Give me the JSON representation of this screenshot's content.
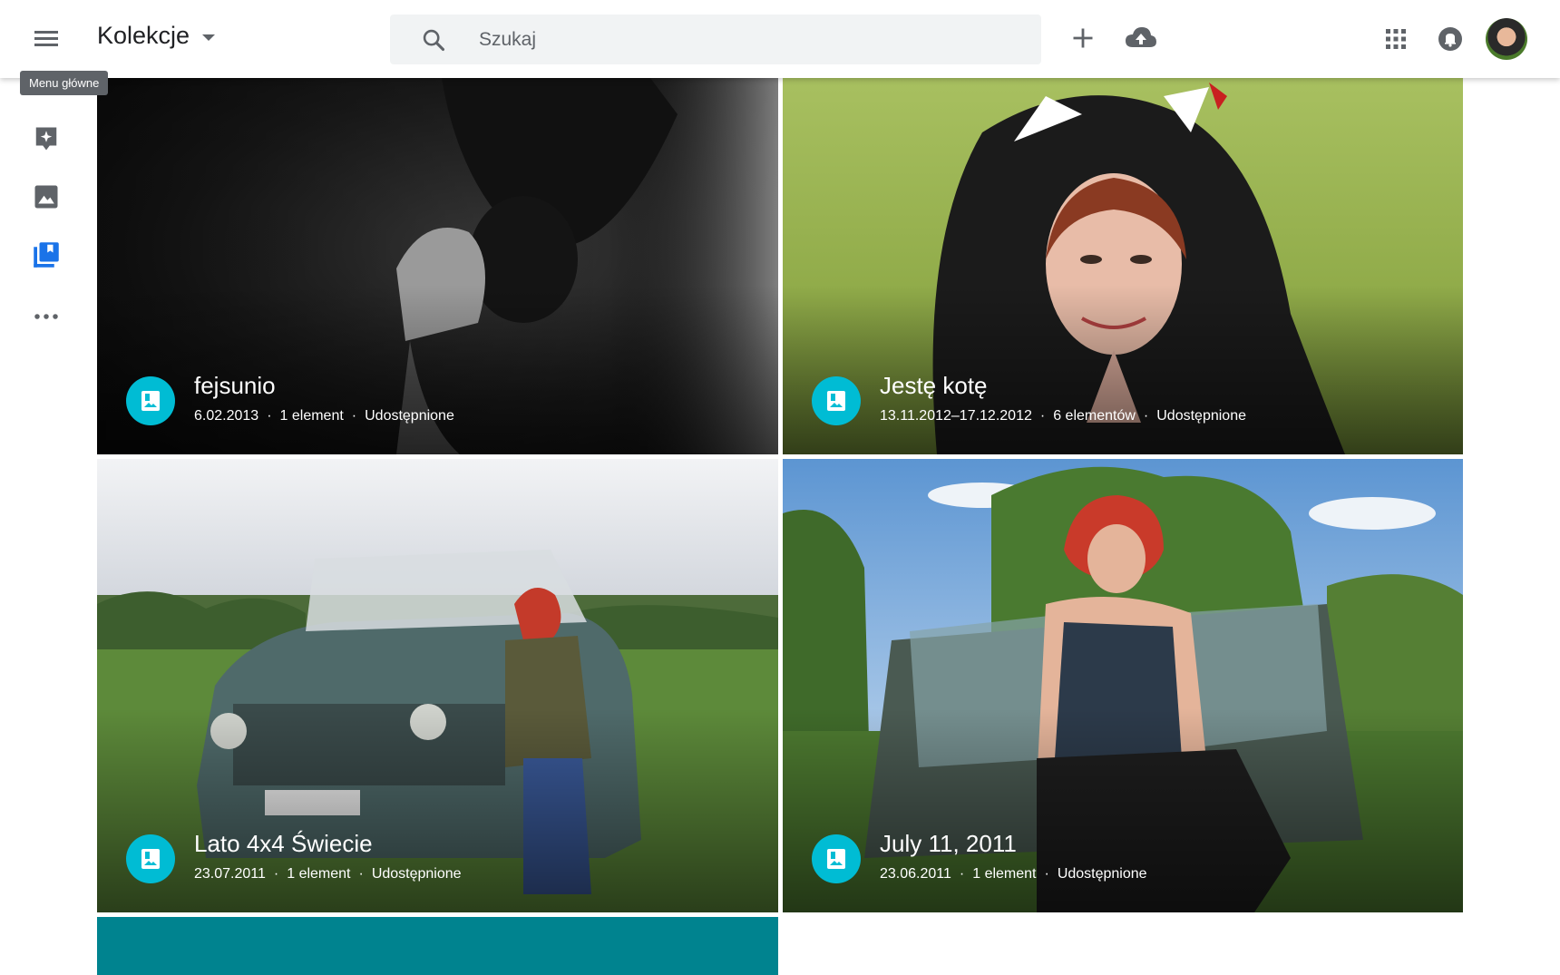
{
  "header": {
    "app_title": "Kolekcje",
    "search_placeholder": "Szukaj"
  },
  "tooltip": {
    "text": "Menu główne"
  },
  "icons": {
    "menu": "hamburger-menu-icon",
    "search": "search-icon",
    "add": "plus-icon",
    "upload": "cloud-upload-icon",
    "apps": "apps-grid-icon",
    "notifications": "notification-bell-icon",
    "rail": [
      "assistant-sparkle-icon",
      "photos-icon",
      "albums-icon",
      "more-horizontal-icon"
    ]
  },
  "colors": {
    "accent": "#00bcd4",
    "active_rail": "#1a73e8",
    "icon_gray": "#5f6368",
    "placeholder_card": "#00838f"
  },
  "collections": [
    {
      "title": "fejsunio",
      "date": "6.02.2013",
      "count": "1 element",
      "sharing": "Udostępnione"
    },
    {
      "title": "Jestę kotę",
      "date": "13.11.2012–17.12.2012",
      "count": "6 elementów",
      "sharing": "Udostępnione"
    },
    {
      "title": "Lato 4x4 Świecie",
      "date": "23.07.2011",
      "count": "1 element",
      "sharing": "Udostępnione"
    },
    {
      "title": "July 11, 2011",
      "date": "23.06.2011",
      "count": "1 element",
      "sharing": "Udostępnione"
    }
  ]
}
